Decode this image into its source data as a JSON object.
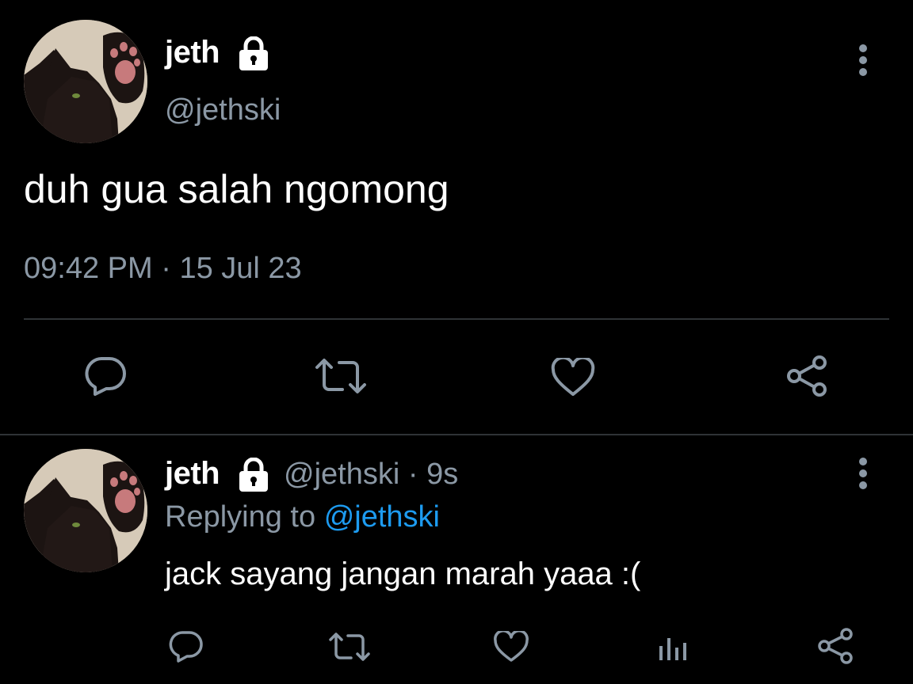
{
  "colors": {
    "background": "#000000",
    "primary_text": "#ffffff",
    "secondary_text": "#8b98a5",
    "link": "#1d9bf0",
    "divider": "#2f3336",
    "icon": "#8b98a5"
  },
  "main_tweet": {
    "display_name": "jeth",
    "locked_icon": "lock-icon",
    "handle": "@jethski",
    "text": "duh gua salah ngomong",
    "time": "09:42 PM",
    "separator": "·",
    "date": "15 Jul 23",
    "actions": [
      "reply-icon",
      "retweet-icon",
      "like-icon",
      "share-icon"
    ]
  },
  "reply_tweet": {
    "display_name": "jeth",
    "locked_icon": "lock-icon",
    "handle": "@jethski",
    "separator": "·",
    "age": "9s",
    "replying_prefix": "Replying to",
    "replying_handle": "@jethski",
    "text": "jack sayang jangan marah yaaa :(",
    "actions": [
      "reply-icon",
      "retweet-icon",
      "like-icon",
      "analytics-icon",
      "share-icon"
    ]
  }
}
